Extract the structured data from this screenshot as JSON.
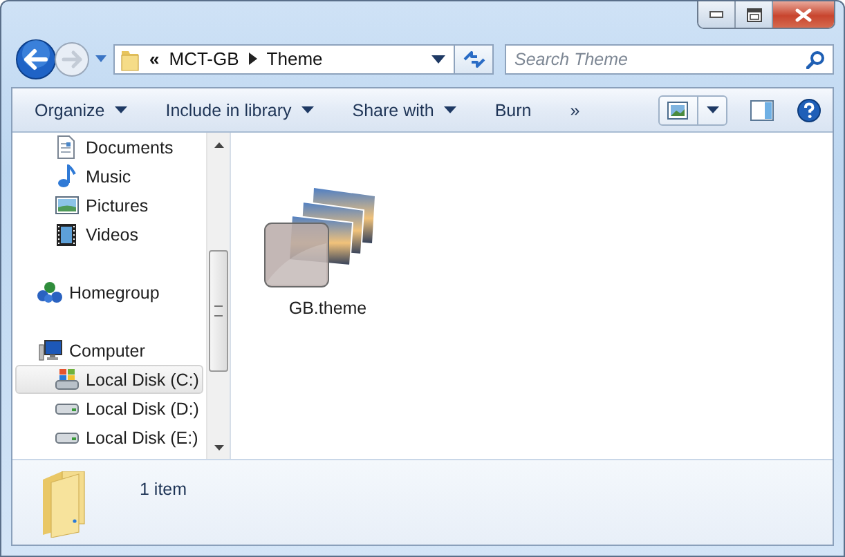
{
  "address": {
    "overflow": "«",
    "path": [
      "MCT-GB",
      "Theme"
    ]
  },
  "search": {
    "placeholder": "Search Theme"
  },
  "toolbar": [
    {
      "label": "Organize",
      "dropdown": true
    },
    {
      "label": "Include in library",
      "dropdown": true
    },
    {
      "label": "Share with",
      "dropdown": true
    },
    {
      "label": "Burn",
      "dropdown": false
    },
    {
      "label": "»",
      "dropdown": false
    }
  ],
  "libraries": [
    {
      "label": "Documents",
      "kind": "documents",
      "selected": false
    },
    {
      "label": "Music",
      "kind": "music",
      "selected": false
    },
    {
      "label": "Pictures",
      "kind": "pictures",
      "selected": false
    },
    {
      "label": "Videos",
      "kind": "videos",
      "selected": false
    }
  ],
  "navigation": [
    {
      "label": "Homegroup",
      "kind": "homegroup",
      "selected": false
    },
    {
      "label": "Computer",
      "kind": "computer",
      "selected": false,
      "children": [
        {
          "label": "Local Disk (C:)",
          "kind": "system-disk",
          "selected": true
        },
        {
          "label": "Local Disk (D:)",
          "kind": "disk",
          "selected": false
        },
        {
          "label": "Local Disk (E:)",
          "kind": "disk",
          "selected": false
        }
      ]
    }
  ],
  "files": [
    {
      "name": "GB.theme",
      "kind": "theme"
    }
  ],
  "status_bar": {
    "count": "1 item"
  }
}
